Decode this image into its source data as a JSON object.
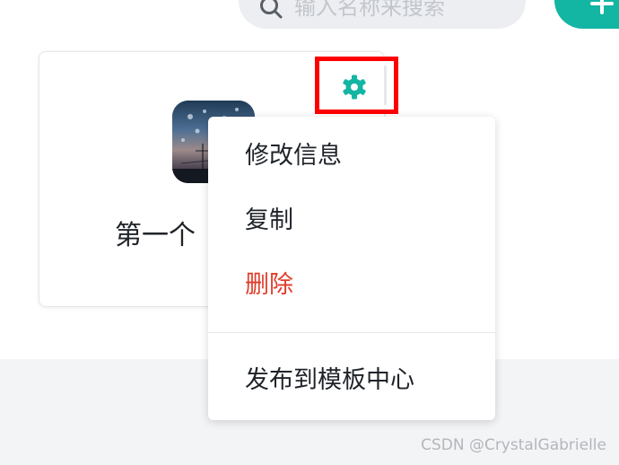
{
  "search": {
    "placeholder": "输入名称来搜索",
    "icon": "search-icon"
  },
  "toolbar": {
    "add_icon": "plus-icon",
    "accent_color": "#13b5a3"
  },
  "app_card": {
    "name": "第一个",
    "settings_icon": "gear-icon",
    "highlight_color": "#ff0000"
  },
  "menu": {
    "items": [
      {
        "label": "修改信息",
        "danger": false
      },
      {
        "label": "复制",
        "danger": false
      },
      {
        "label": "删除",
        "danger": true
      },
      {
        "label": "发布到模板中心",
        "danger": false
      }
    ],
    "danger_color": "#e03c2a"
  },
  "watermark": "CSDN @CrystalGabrielle"
}
